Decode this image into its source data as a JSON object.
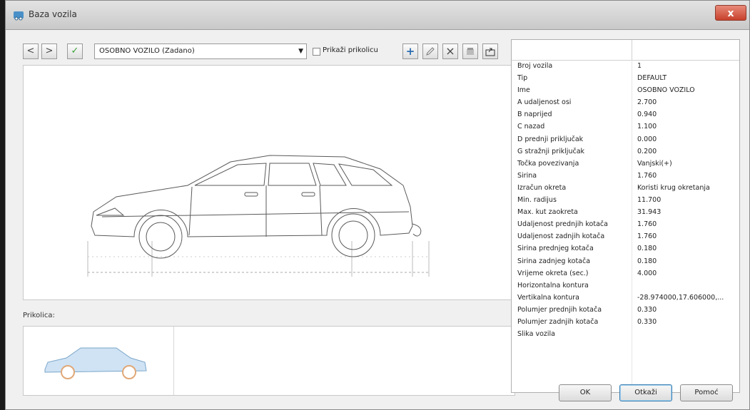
{
  "window": {
    "title": "Baza vozila",
    "close_symbol": "x"
  },
  "toolbar": {
    "prev_symbol": "<",
    "next_symbol": ">",
    "confirm_symbol": "✓",
    "vehicle_select": "OSOBNO VOZILO (Zadano)",
    "show_trailer_label": "Prikaži prikolicu",
    "show_trailer_checked": false,
    "add_symbol": "+",
    "delete_symbol": "×"
  },
  "trailer": {
    "label": "Prikolica:"
  },
  "properties": [
    {
      "name": "Broj vozila",
      "value": "1"
    },
    {
      "name": "Tip",
      "value": "DEFAULT"
    },
    {
      "name": "Ime",
      "value": "OSOBNO VOZILO"
    },
    {
      "name": "A udaljenost osi",
      "value": "2.700"
    },
    {
      "name": "B naprijed",
      "value": "0.940"
    },
    {
      "name": "C nazad",
      "value": "1.100"
    },
    {
      "name": "D prednji priključak",
      "value": "0.000"
    },
    {
      "name": "G stražnji priključak",
      "value": "0.200"
    },
    {
      "name": "Točka povezivanja",
      "value": "Vanjski(+)"
    },
    {
      "name": "Širina",
      "value": "1.760"
    },
    {
      "name": "Izračun okreta",
      "value": "Koristi krug okretanja"
    },
    {
      "name": "Min. radijus",
      "value": "11.700"
    },
    {
      "name": "Max. kut zaokreta",
      "value": "31.943"
    },
    {
      "name": "Udaljenost prednjih kotača",
      "value": "1.760"
    },
    {
      "name": "Udaljenost zadnjih kotača",
      "value": "1.760"
    },
    {
      "name": "Širina prednjeg kotača",
      "value": "0.180"
    },
    {
      "name": "Širina zadnjeg kotača",
      "value": "0.180"
    },
    {
      "name": "Vrijeme okreta (sec.)",
      "value": "4.000"
    },
    {
      "name": "Horizontalna kontura",
      "value": ""
    },
    {
      "name": "Vertikalna kontura",
      "value": "-28.974000,17.606000,..."
    },
    {
      "name": "Polumjer prednjih kotača",
      "value": "0.330"
    },
    {
      "name": "Polumjer zadnjih kotača",
      "value": "0.330"
    },
    {
      "name": "Slika vozila",
      "value": ""
    }
  ],
  "buttons": {
    "ok": "OK",
    "cancel": "Otkaži",
    "help": "Pomoć"
  }
}
